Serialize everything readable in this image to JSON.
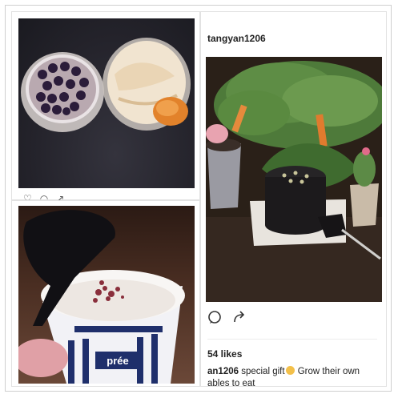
{
  "post": {
    "username": "tangyan1206",
    "likes": "54 likes",
    "caption_user": "an1206",
    "caption_text_1": " special gift",
    "caption_text_2": " Grow their own",
    "caption_line2": "ables to eat",
    "emoji": "grinning-face-emoji"
  },
  "images": {
    "bowls": "two bowls of dessert",
    "icecream": "ice cream cup",
    "salad": "potted salad"
  },
  "brand_text": "prée",
  "icons": {
    "heart": "heart-icon",
    "comment": "comment-icon",
    "share": "share-icon"
  }
}
